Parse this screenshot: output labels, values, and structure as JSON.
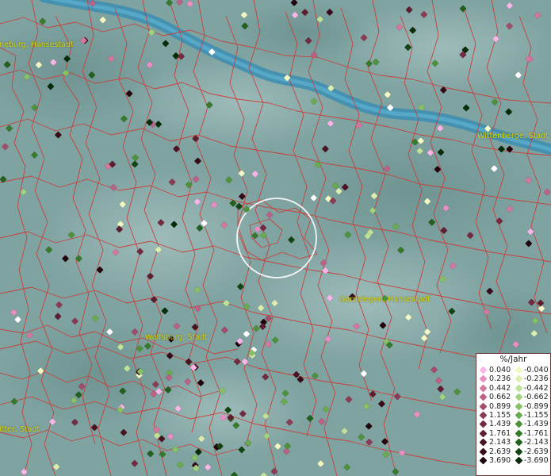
{
  "map": {
    "place_labels": {
      "lueneburg": "neburg, Hansestadt",
      "wittenberge": "Wittenberge, Stadt",
      "gardelegen": "Gardelegen, Hansestadt",
      "wolfsburg": "Wolfsburg, Stadt",
      "gifhorn": "itter, Stadt"
    },
    "colors": {
      "background": "#7fa3a1",
      "river": "#3f8fb0",
      "boundaries": "#c8403c",
      "label_text": "#d8d200"
    }
  },
  "legend": {
    "title": "%/Jahr",
    "rows": [
      {
        "pos": "0.040",
        "pos_color": "#f7b6e6",
        "neg": "-0.040",
        "neg_color": "#f2f8c4"
      },
      {
        "pos": "0.236",
        "pos_color": "#e98fc3",
        "neg": "-0.236",
        "neg_color": "#dbeeb0"
      },
      {
        "pos": "0.442",
        "pos_color": "#d3789f",
        "neg": "-0.442",
        "neg_color": "#bfe198"
      },
      {
        "pos": "0.662",
        "pos_color": "#bb6287",
        "neg": "-0.662",
        "neg_color": "#a2d27f"
      },
      {
        "pos": "0.899",
        "pos_color": "#a24d6c",
        "neg": "-0.899",
        "neg_color": "#86c166"
      },
      {
        "pos": "1.155",
        "pos_color": "#8c3b55",
        "neg": "-1.155",
        "neg_color": "#6aab4f"
      },
      {
        "pos": "1.439",
        "pos_color": "#742a40",
        "neg": "-1.439",
        "neg_color": "#4f923c"
      },
      {
        "pos": "1.761",
        "pos_color": "#5e1e30",
        "neg": "-1.761",
        "neg_color": "#377a2c"
      },
      {
        "pos": "2.143",
        "pos_color": "#4a1322",
        "neg": "-2.143",
        "neg_color": "#22601d"
      },
      {
        "pos": "2.639",
        "pos_color": "#370a17",
        "neg": "-2.639",
        "neg_color": "#134512"
      },
      {
        "pos": "3.690",
        "pos_color": "#24040c",
        "neg": "-3.690",
        "neg_color": "#062c08"
      }
    ]
  }
}
